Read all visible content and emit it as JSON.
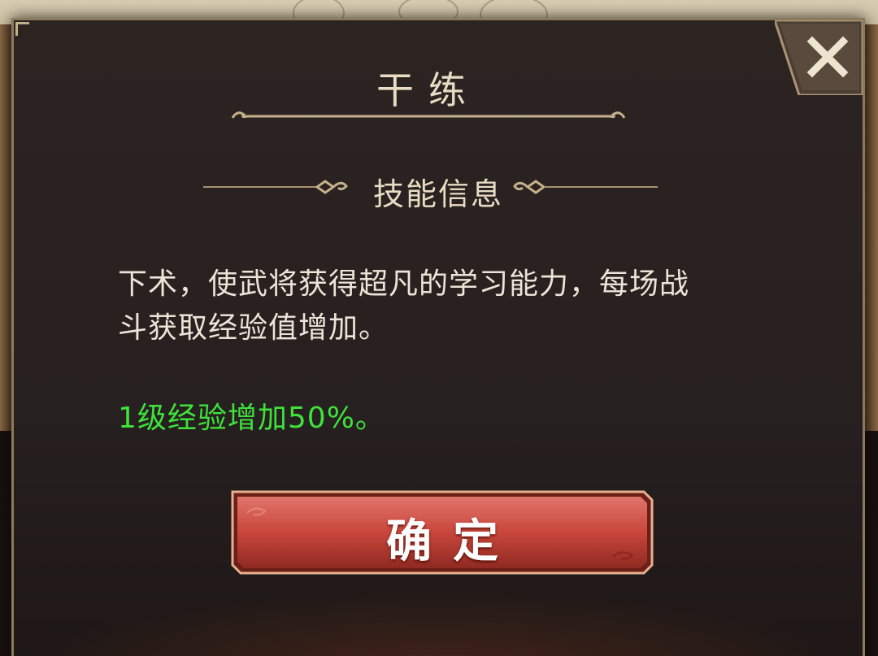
{
  "dialog": {
    "title": "干练",
    "close_icon": "close-x-icon"
  },
  "section": {
    "title": "技能信息"
  },
  "skill": {
    "description_line1": "下术，使武将获得超凡的学习能力，每场战",
    "description_line2": "斗获取经验值增加。",
    "effect": "1级经验增加50%。"
  },
  "confirm": {
    "label": "确定"
  },
  "colors": {
    "effect_text": "#3ee23a",
    "frame_gold": "#c4b08a",
    "button_red": "#c9463b",
    "panel_bg": "#2b2320"
  }
}
